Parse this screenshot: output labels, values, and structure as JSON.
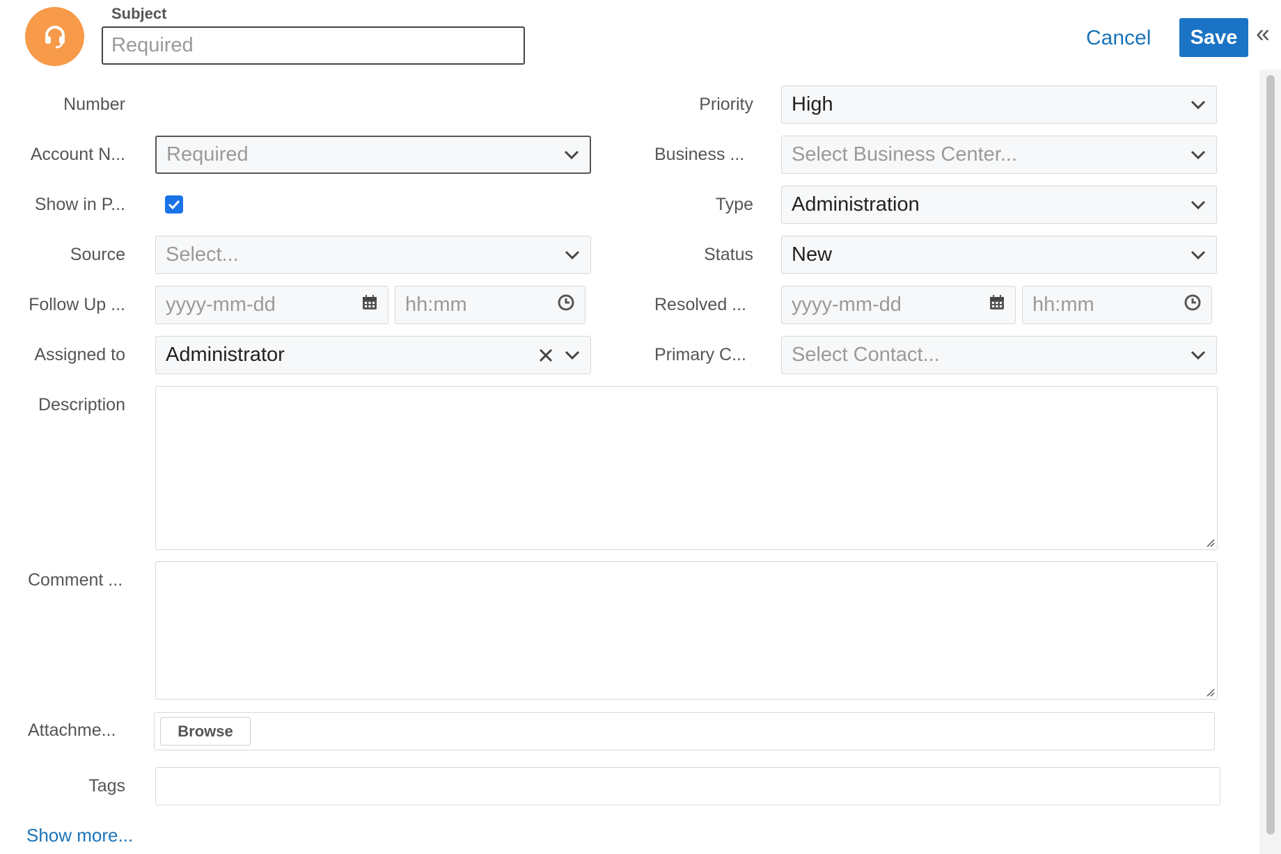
{
  "header": {
    "subject_label": "Subject",
    "subject_placeholder": "Required",
    "cancel_label": "Cancel",
    "save_label": "Save",
    "collapse_glyph": "«",
    "avatar_icon": "headset-icon",
    "avatar_color": "#f79a49",
    "accent_color": "#1a73c5"
  },
  "form": {
    "number_label": "Number",
    "account_label": "Account N...",
    "account_placeholder": "Required",
    "show_in_portal_label": "Show in P...",
    "show_in_portal_checked": true,
    "source_label": "Source",
    "source_placeholder": "Select...",
    "follow_up_label": "Follow Up ...",
    "follow_up_date_placeholder": "yyyy-mm-dd",
    "follow_up_time_placeholder": "hh:mm",
    "assigned_label": "Assigned to",
    "assigned_value": "Administrator",
    "priority_label": "Priority",
    "priority_value": "High",
    "business_label": "Business ...",
    "business_placeholder": "Select Business Center...",
    "type_label": "Type",
    "type_value": "Administration",
    "status_label": "Status",
    "status_value": "New",
    "resolved_label": "Resolved ...",
    "resolved_date_placeholder": "yyyy-mm-dd",
    "resolved_time_placeholder": "hh:mm",
    "primary_contact_label": "Primary C...",
    "primary_contact_placeholder": "Select Contact...",
    "description_label": "Description",
    "comment_label": "Comment ...",
    "attachments_label": "Attachme...",
    "browse_label": "Browse",
    "tags_label": "Tags",
    "show_more_label": "Show more..."
  }
}
